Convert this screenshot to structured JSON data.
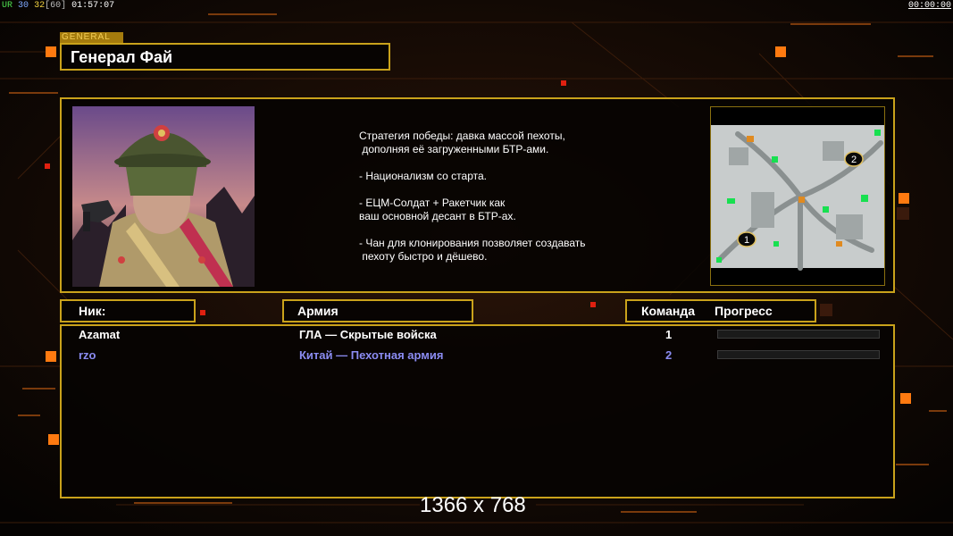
{
  "hud": {
    "ur": "UR",
    "n1": "30",
    "n2": "32",
    "bracket": "[60]",
    "time": "01:57:07",
    "timer": "00:00:00"
  },
  "general": {
    "tag": "GENERAL",
    "name": "Генерал Фай",
    "description": [
      "Стратегия победы: давка массой пехоты,",
      " дополняя её загруженными БТР-ами.",
      "",
      "- Национализм со старта.",
      "",
      "- ЕЦМ-Солдат + Ракетчик как",
      "ваш основной десант в БТР-ах.",
      "",
      "- Чан для клонирования позволяет создавать",
      " пехоту быстро и дёшево."
    ]
  },
  "minimap": {
    "start_positions": [
      "1",
      "2"
    ]
  },
  "table": {
    "headers": {
      "nick": "Ник:",
      "army": "Армия",
      "team": "Команда",
      "progress": "Прогресс"
    },
    "rows": [
      {
        "nick": "Azamat",
        "army": "ГЛА — Скрытые войска",
        "team": "1",
        "progress": 0,
        "color": "#ffffff"
      },
      {
        "nick": "rzo",
        "army": "Китай — Пехотная армия",
        "team": "2",
        "progress": 0,
        "color": "#8b8cf2"
      }
    ]
  },
  "overlay": {
    "resolution": "1366 x 768"
  },
  "colors": {
    "accent": "#c9a21b",
    "orange": "#ff7a10",
    "red": "#e02010",
    "player2": "#8b8cf2"
  }
}
